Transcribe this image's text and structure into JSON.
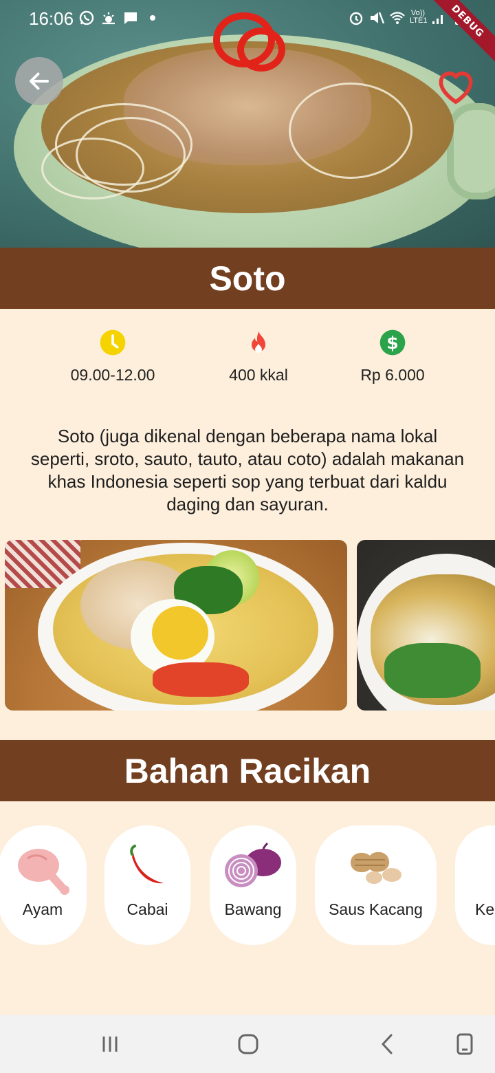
{
  "status_bar": {
    "time": "16:06",
    "network_label": "Vo)) LTE1",
    "debug_label": "DEBUG"
  },
  "food": {
    "title": "Soto",
    "info": [
      {
        "icon": "clock-icon",
        "value": "09.00-12.00",
        "color": "#f5d300"
      },
      {
        "icon": "fire-icon",
        "value": "400 kkal",
        "color": "#f0473a"
      },
      {
        "icon": "dollar-icon",
        "value": "Rp 6.000",
        "color": "#2aa34a"
      }
    ],
    "description": "Soto (juga dikenal dengan beberapa nama lokal seperti, sroto, sauto, tauto, atau coto) adalah makanan khas Indonesia seperti sop yang terbuat dari kaldu daging dan sayuran."
  },
  "ingredients": {
    "title": "Bahan Racikan",
    "items": [
      {
        "label": "Ayam",
        "icon": "chicken-icon"
      },
      {
        "label": "Cabai",
        "icon": "chili-icon"
      },
      {
        "label": "Bawang",
        "icon": "onion-icon"
      },
      {
        "label": "Saus Kacang",
        "icon": "peanut-icon"
      },
      {
        "label": "Ke",
        "icon": "soy-sauce-icon"
      }
    ]
  },
  "colors": {
    "header_brown": "#723f20",
    "background": "#fdefdc",
    "favorite_red": "#e53935"
  }
}
